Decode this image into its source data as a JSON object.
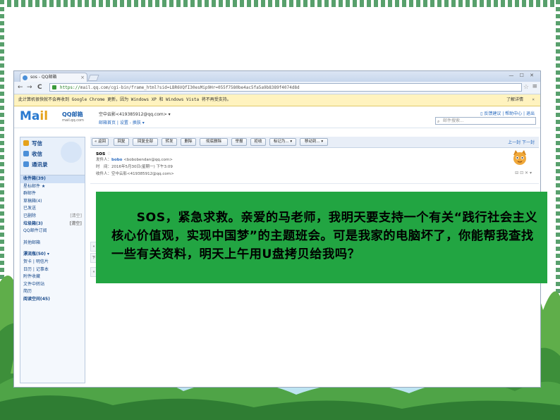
{
  "colors": {
    "frame_stripe": "#58a06c",
    "overlay_green": "#22a542",
    "infobar_yellow": "#fff3bf",
    "qq_blue": "#2a7ad0"
  },
  "browser": {
    "tab_title": "sos - QQ邮箱",
    "tab_close": "×",
    "window_buttons": "— ☐ ✕",
    "nav": {
      "back": "←",
      "forward": "→",
      "reload": "C"
    },
    "url_scheme": "https://",
    "url_host": "mail.qq.com",
    "url_path": "/cgi-bin/frame_html?sid=LBR6VQfI30esMip9Hr=055f7580be4ac5fa5a9b8389f4074d8d",
    "bookmark_icon": "star-icon",
    "menu_icon": "menu-icon"
  },
  "infobar": {
    "message": "此计算机很快就不会再收到 Google Chrome 更新，因为 Windows XP 和 Windows Vista 将不再受支持。",
    "learn_more": "了解详情",
    "close": "×"
  },
  "mail": {
    "logo_text": "Ma",
    "logo_il": "il",
    "logo_name": "QQ邮箱",
    "logo_domain": "mail.qq.com",
    "account": "空中云影<419385912@qq.com> ▾",
    "account_links": "邮箱首页 | 设置 - 换肤 ▾",
    "top_links": "▯ 反馈建议 | 帮助中心 | 退出",
    "search_placeholder": "邮件搜索...",
    "search_icon": "search-icon"
  },
  "sidebar": {
    "quick": [
      {
        "label": "写信",
        "icon": "pencil-icon",
        "color": "#e5a21b"
      },
      {
        "label": "收信",
        "icon": "inbox-icon",
        "color": "#4b8fd8"
      },
      {
        "label": "通讯录",
        "icon": "contacts-icon",
        "color": "#4b8fd8"
      }
    ],
    "folders": [
      {
        "label": "收件箱(39)",
        "right": ""
      },
      {
        "label": "星标邮件 ★",
        "right": ""
      },
      {
        "label": "群邮件",
        "right": ""
      },
      {
        "label": "草稿箱(4)",
        "right": ""
      },
      {
        "label": "已发送",
        "right": ""
      },
      {
        "label": "已删除",
        "right": "[清空]"
      },
      {
        "label": "垃圾箱(3)",
        "right": "[清空]"
      },
      {
        "label": "QQ邮件订阅",
        "right": ""
      },
      {
        "label": "其他邮箱",
        "right": ""
      },
      {
        "label": "漂流瓶(50) ▾",
        "right": ""
      },
      {
        "label": "贺卡 | 明信片",
        "right": ""
      },
      {
        "label": "日历 | 记事本",
        "right": ""
      },
      {
        "label": "附件收藏",
        "right": ""
      },
      {
        "label": "文件中转站",
        "right": ""
      },
      {
        "label": "简历",
        "right": ""
      },
      {
        "label": "阅读空间(45)",
        "right": ""
      }
    ]
  },
  "toolbar": {
    "buttons": [
      "« 返回",
      "回复",
      "回复全部",
      "转发",
      "删除",
      "彻底删除",
      "举报",
      "拒收",
      "标记为... ▾",
      "移动到... ▾"
    ],
    "pager": "上一封  下一封"
  },
  "message": {
    "subject": "sos",
    "subject_star": "☆",
    "from_label": "发件人：",
    "from_name": "bobo",
    "from_addr": "<bobobendan@qq.com>",
    "time_label": "时　间：",
    "time": "2016年5月30日(星期一) 下午3:09",
    "to_label": "收件人：",
    "to": "空中云影<419385912@qq.com>",
    "icons": "⊟ ⊡ ✕ ▾",
    "avatar_icon": "cat-avatar-icon",
    "stubs": [
      "«",
      "下",
      "«"
    ]
  },
  "overlay_text": "　　SOS，紧急求救。亲爱的马老师，我明天要支持一个有关“践行社会主义核心价值观，实现中国梦”的主题班会。可是我家的电脑坏了，你能帮我查找一些有关资料，明天上午用U盘拷贝给我吗？"
}
